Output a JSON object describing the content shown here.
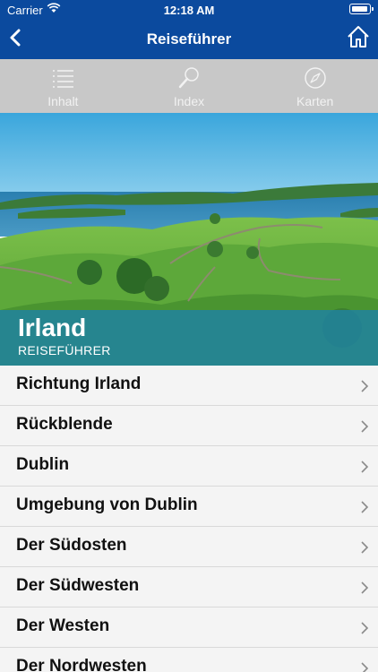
{
  "status_bar": {
    "carrier": "Carrier",
    "time": "12:18 AM"
  },
  "nav": {
    "title": "Reiseführer",
    "back_icon": "chevron-left-icon",
    "home_icon": "home-icon"
  },
  "tabs": [
    {
      "label": "Inhalt",
      "icon": "list-icon"
    },
    {
      "label": "Index",
      "icon": "magnifier-icon"
    },
    {
      "label": "Karten",
      "icon": "compass-icon"
    }
  ],
  "hero": {
    "title": "Irland",
    "subtitle": "REISEFÜHRER"
  },
  "list": {
    "items": [
      "Richtung Irland",
      "Rückblende",
      "Dublin",
      "Umgebung von Dublin",
      "Der Südosten",
      "Der Südwesten",
      "Der Westen",
      "Der Nordwesten"
    ]
  },
  "colors": {
    "nav_bar": "#0b4a9e",
    "tab_bar": "#c8c8c8",
    "overlay": "#1c82aa",
    "list_bg": "#f4f4f4"
  }
}
